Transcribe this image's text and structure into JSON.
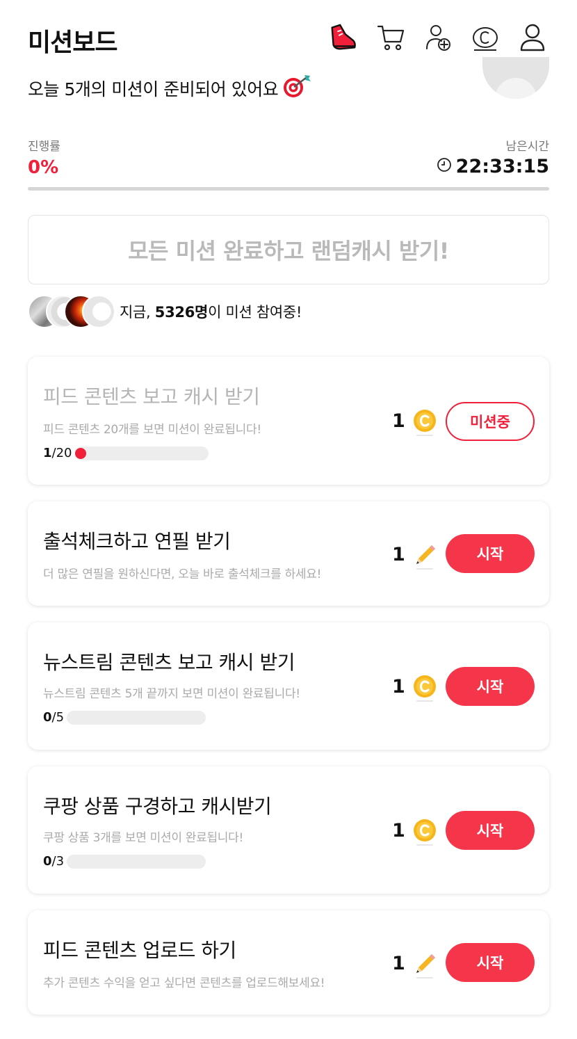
{
  "header": {
    "title": "미션보드",
    "icons": [
      "shoe-icon",
      "cart-icon",
      "add-friend-icon",
      "coin-c-icon",
      "user-icon"
    ]
  },
  "subtitle": {
    "text": "오늘 5개의 미션이 준비되어 있어요",
    "icon": "target-icon"
  },
  "progress": {
    "label": "진행률",
    "value": "0%",
    "fraction": 0
  },
  "remaining": {
    "label": "남은시간",
    "value": "22:33:15"
  },
  "banner": {
    "text": "모든 미션 완료하고 랜덤캐시 받기!"
  },
  "participants": {
    "prefix": "지금, ",
    "count": "5326명",
    "suffix": "이 미션 참여중!"
  },
  "missions": [
    {
      "title": "피드 콘텐츠 보고 캐시 받기",
      "desc": "피드 콘텐츠 20개를 보면 미션이 완료됩니다!",
      "done": "1",
      "total": "/20",
      "fraction": 0.05,
      "reward": "1",
      "reward_icon": "cash-coin-icon",
      "button": "미션중",
      "state": "in-progress"
    },
    {
      "title": "출석체크하고 연필 받기",
      "desc": "더 많은 연필을 원하신다면, 오늘 바로 출석체크를 하세요!",
      "reward": "1",
      "reward_icon": "pencil-icon",
      "button": "시작",
      "state": "start"
    },
    {
      "title": "뉴스트림 콘텐츠 보고 캐시 받기",
      "desc": "뉴스트림 콘텐츠 5개 끝까지 보면 미션이 완료됩니다!",
      "done": "0",
      "total": "/5",
      "fraction": 0,
      "reward": "1",
      "reward_icon": "cash-coin-icon",
      "button": "시작",
      "state": "start"
    },
    {
      "title": "쿠팡 상품 구경하고 캐시받기",
      "desc": "쿠팡 상품 3개를 보면 미션이 완료됩니다!",
      "done": "0",
      "total": "/3",
      "fraction": 0,
      "reward": "1",
      "reward_icon": "cash-coin-icon",
      "button": "시작",
      "state": "start"
    },
    {
      "title": "피드 콘텐츠 업로드 하기",
      "desc": "추가 콘텐츠 수익을 얻고 싶다면 콘텐츠를 업로드해보세요!",
      "reward": "1",
      "reward_icon": "pencil-icon",
      "button": "시작",
      "state": "start"
    }
  ],
  "colors": {
    "accent": "#f0203a",
    "button": "#f5364a",
    "coin": "#f7b51c",
    "pencil": "#f6b621"
  }
}
